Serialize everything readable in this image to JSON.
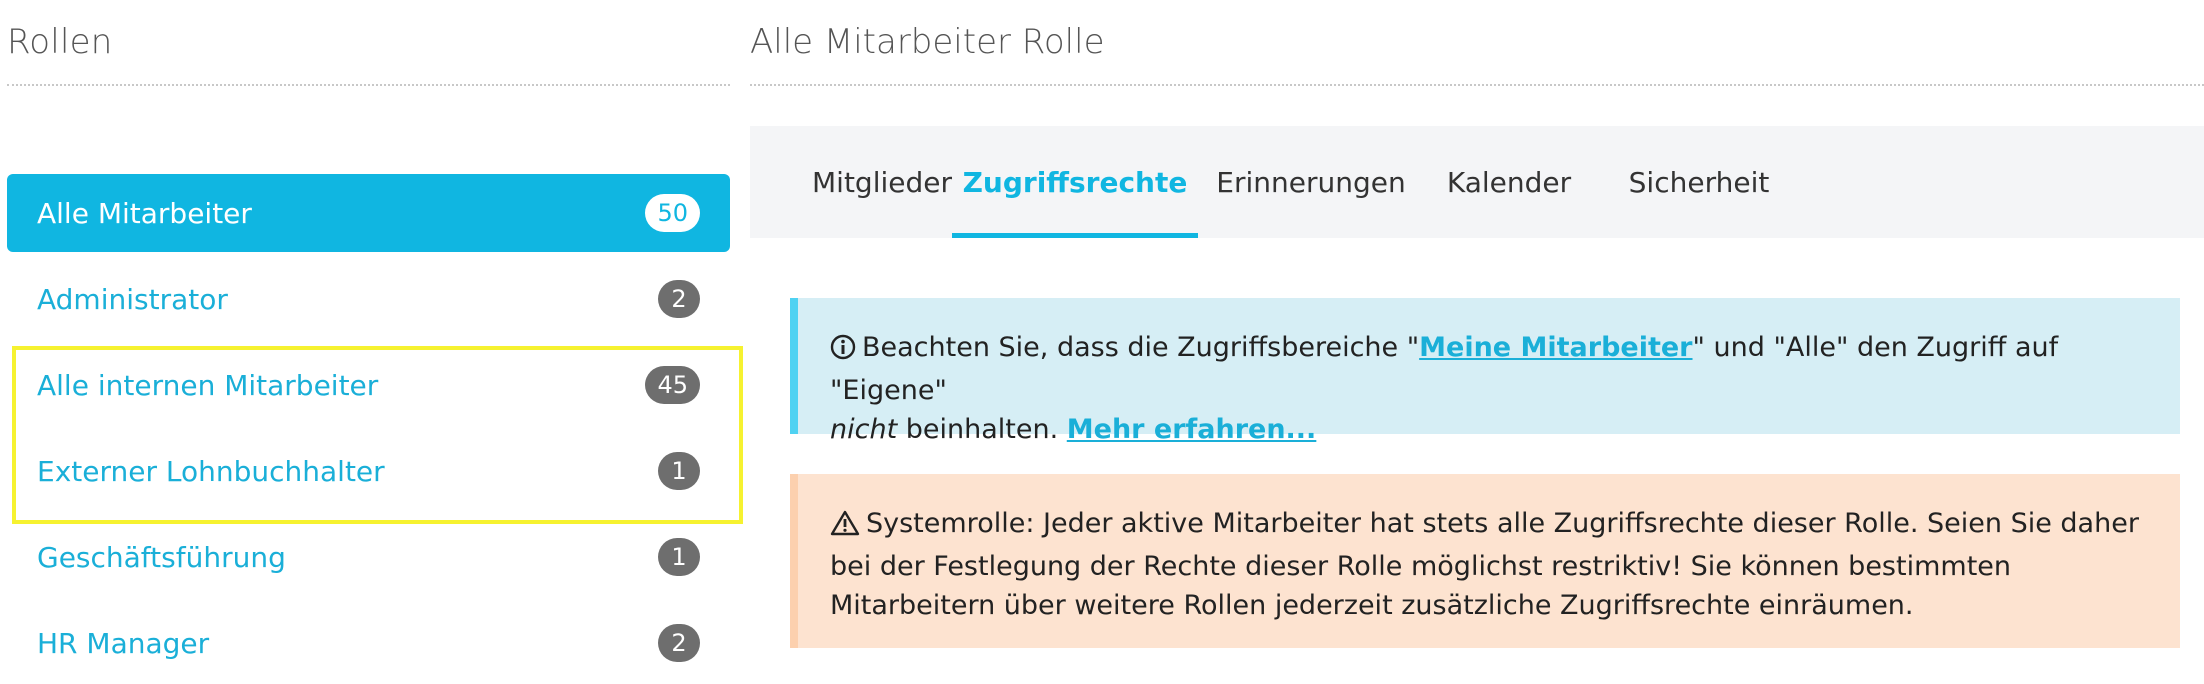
{
  "left": {
    "title": "Rollen",
    "roles": [
      {
        "label": "Alle Mitarbeiter",
        "count": "50",
        "active": true
      },
      {
        "label": "Administrator",
        "count": "2"
      },
      {
        "label": "Alle internen Mitarbeiter",
        "count": "45"
      },
      {
        "label": "Externer Lohnbuchhalter",
        "count": "1"
      },
      {
        "label": "Geschäftsführung",
        "count": "1"
      },
      {
        "label": "HR Manager",
        "count": "2"
      }
    ]
  },
  "right": {
    "title": "Alle Mitarbeiter Rolle",
    "tabs": [
      {
        "label": "Mitglieder"
      },
      {
        "label": "Zugriffsrechte",
        "active": true
      },
      {
        "label": "Erinnerungen"
      },
      {
        "label": "Kalender"
      },
      {
        "label": "Sicherheit"
      }
    ],
    "info": {
      "text_1": "Beachten Sie, dass die Zugriffsbereiche \"",
      "link_1": "Meine Mitarbeiter",
      "text_2": "\" und \"Alle\" den Zugriff auf \"Eigene\"",
      "text_italic": "nicht",
      "text_3": " beinhalten. ",
      "link_2": "Mehr erfahren..."
    },
    "warning": {
      "text": "Systemrolle: Jeder aktive Mitarbeiter hat stets alle Zugriffsrechte dieser Rolle. Seien Sie daher bei der Festlegung der Rechte dieser Rolle möglichst restriktiv! Sie können bestimmten Mitarbeitern über weitere Rollen jederzeit zusätzliche Zugriffsrechte einräumen."
    }
  },
  "colors": {
    "accent": "#10b6e1",
    "highlight": "#f6f230",
    "info_bg": "#d6eef5",
    "warning_bg": "#fde3d0"
  }
}
